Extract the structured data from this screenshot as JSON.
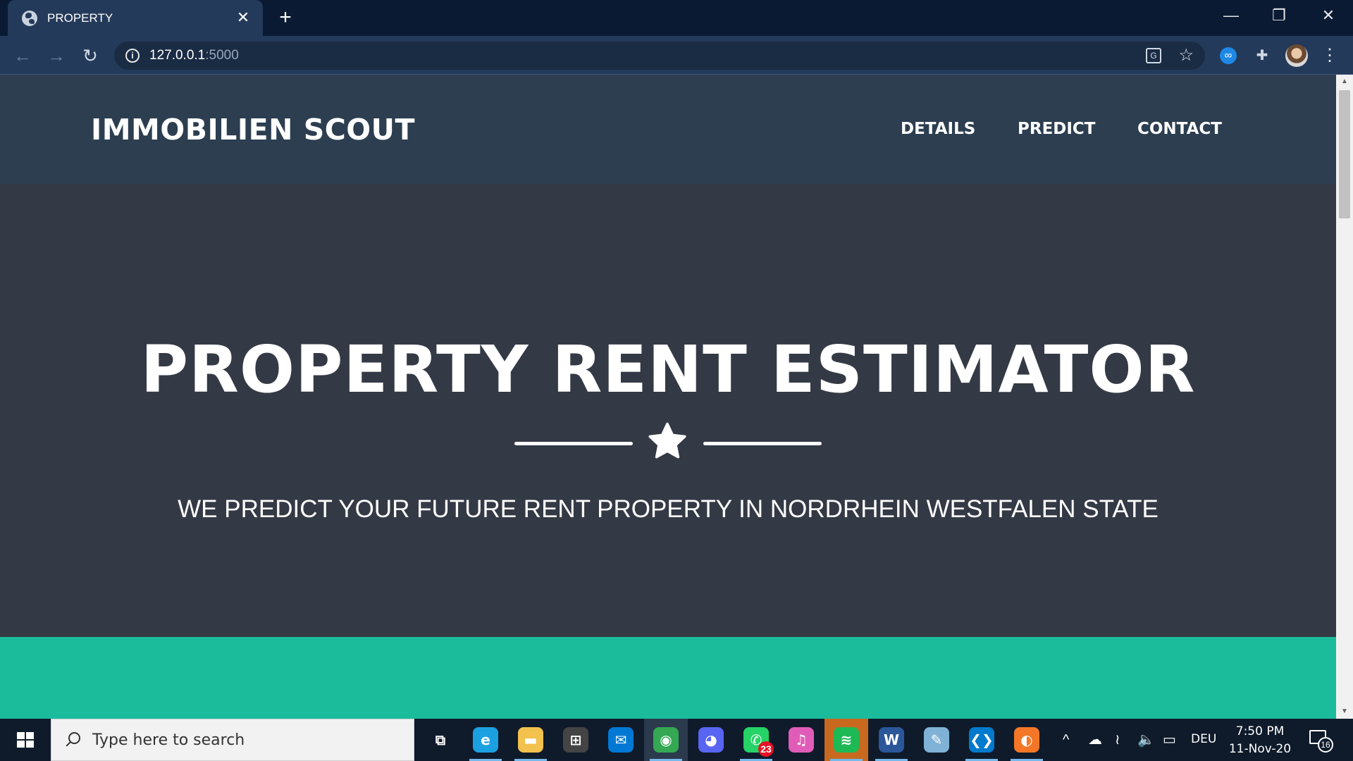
{
  "browser": {
    "tab_title": "PROPERTY",
    "tab_close": "✕",
    "new_tab": "+",
    "url_host": "127.0.0.1",
    "url_port": ":5000",
    "window_controls": {
      "minimize": "—",
      "restore": "❐",
      "close": "✕"
    },
    "nav": {
      "back": "←",
      "forward": "→",
      "reload": "↻"
    },
    "icons": {
      "info": "i",
      "translate": "G",
      "bookmark": "☆",
      "extensions": "✚",
      "menu": "⋮",
      "infinity": "∞"
    }
  },
  "site": {
    "brand": "IMMOBILIEN SCOUT",
    "nav_links": [
      "DETAILS",
      "PREDICT",
      "CONTACT"
    ],
    "masthead_title": "PROPERTY RENT ESTIMATOR",
    "masthead_subtitle": "WE PREDICT YOUR FUTURE RENT PROPERTY IN NORDRHEIN WESTFALEN STATE",
    "colors": {
      "nav_bg": "#2c3e50",
      "masthead_bg": "#343a45",
      "teal": "#1abc9c"
    }
  },
  "taskbar": {
    "search_placeholder": "Type here to search",
    "apps": [
      {
        "name": "task-view",
        "glyph": "⧉",
        "color": "transparent"
      },
      {
        "name": "edge",
        "glyph": "e",
        "color": "#1ba1e2"
      },
      {
        "name": "file-explorer",
        "glyph": "▬",
        "color": "#f2c14e"
      },
      {
        "name": "microsoft-store",
        "glyph": "⊞",
        "color": "#444444"
      },
      {
        "name": "mail",
        "glyph": "✉",
        "color": "#0078d4"
      },
      {
        "name": "chrome",
        "glyph": "◉",
        "color": "#34a853"
      },
      {
        "name": "discord",
        "glyph": "◕",
        "color": "#5865f2"
      },
      {
        "name": "whatsapp",
        "glyph": "✆",
        "color": "#25d366"
      },
      {
        "name": "itunes",
        "glyph": "♫",
        "color": "#e05cb8"
      },
      {
        "name": "spotify",
        "glyph": "≋",
        "color": "#1db954"
      },
      {
        "name": "word",
        "glyph": "W",
        "color": "#2b579a"
      },
      {
        "name": "notepad",
        "glyph": "✎",
        "color": "#7fb2d6"
      },
      {
        "name": "vscode",
        "glyph": "❮❯",
        "color": "#007acc"
      },
      {
        "name": "jupyter",
        "glyph": "◐",
        "color": "#f37726"
      }
    ],
    "whatsapp_badge": "23",
    "tray": {
      "chevron": "^",
      "cloud": "☁",
      "wifi": "≀",
      "volume": "🔈",
      "battery": "▭"
    },
    "language": "DEU",
    "time": "7:50 PM",
    "date": "11-Nov-20",
    "notification_count": "16"
  }
}
